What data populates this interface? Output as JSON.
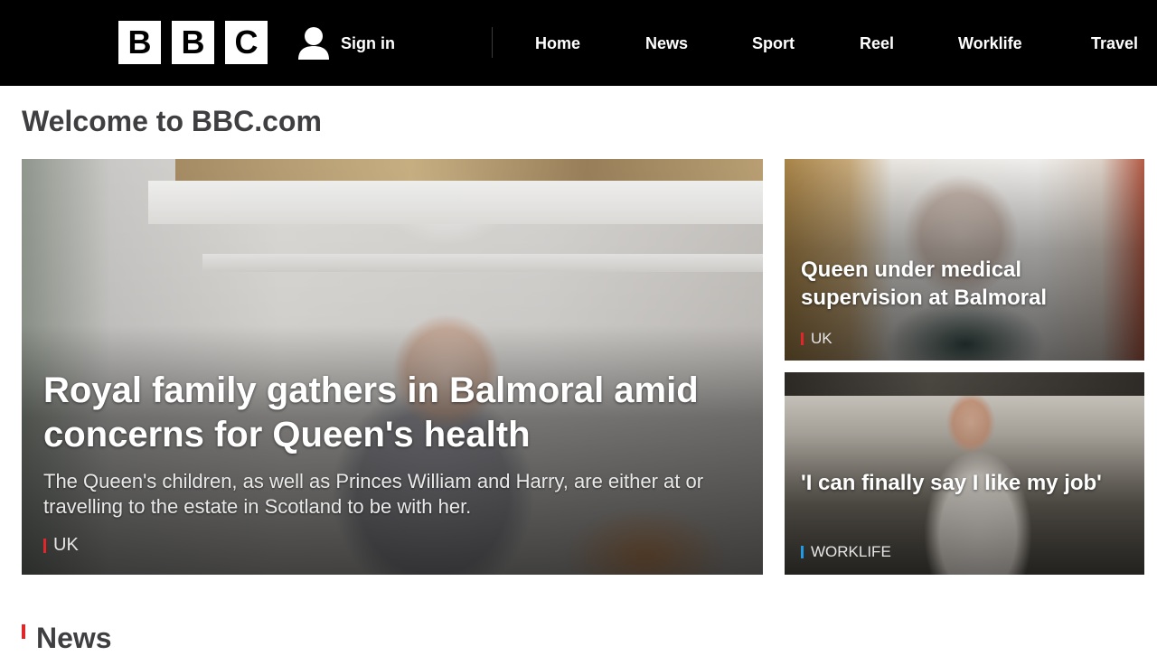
{
  "logo": {
    "letters": [
      "B",
      "B",
      "C"
    ]
  },
  "header": {
    "sign_in_label": "Sign in",
    "nav": [
      "Home",
      "News",
      "Sport",
      "Reel",
      "Worklife",
      "Travel"
    ]
  },
  "page": {
    "title": "Welcome to BBC.com"
  },
  "main_story": {
    "headline": "Royal family gathers in Balmoral amid concerns for Queen's health",
    "summary": "The Queen's children, as well as Princes William and Harry, are either at or travelling to the estate in Scotland to be with her.",
    "tag": "UK"
  },
  "side_stories": [
    {
      "headline": "Queen under medical supervision at Balmoral",
      "tag": "UK"
    },
    {
      "headline": "'I can finally say I like my job'",
      "tag": "WORKLIFE"
    }
  ],
  "section": {
    "label": "News"
  },
  "icons": {
    "user": "user-icon"
  },
  "colors": {
    "header_bg": "#000000",
    "uk_tag": "#e0262b",
    "worklife_tag": "#1f9be6",
    "section_accent": "#e0262b"
  }
}
